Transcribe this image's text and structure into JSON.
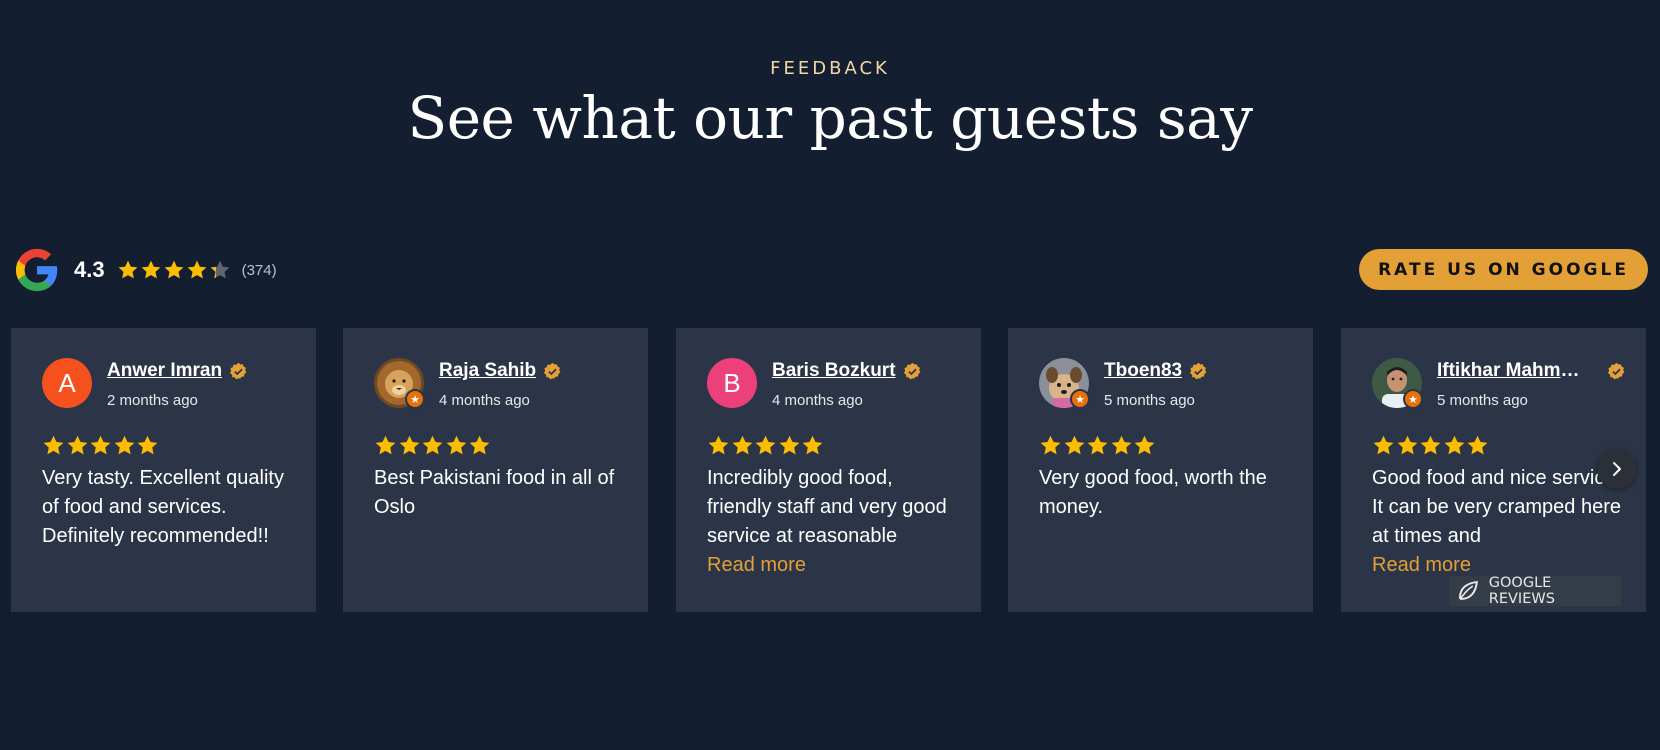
{
  "header": {
    "eyebrow": "FEEDBACK",
    "title": "See what our past guests say"
  },
  "summary": {
    "logo_icon": "google-g-logo-icon",
    "rating": "4.3",
    "rating_value": 4.3,
    "max_stars": 5,
    "count": "(374)",
    "rate_button": "RATE US ON GOOGLE"
  },
  "colors": {
    "background": "#131e30",
    "card": "#2b3547",
    "accent": "#e2a036",
    "star": "#fbbc04",
    "eyebrow": "#f2d7a6"
  },
  "reviews": [
    {
      "name": "Anwer Imran",
      "avatar_letter": "A",
      "avatar_color": "#f4511e",
      "avatar_type": "letter",
      "date": "2 months ago",
      "stars": 5,
      "text": "Very tasty. Excellent quality of food and services. Definitely recommended!!",
      "read_more": ""
    },
    {
      "name": "Raja Sahib",
      "avatar_type": "photo",
      "avatar_icon": "lion-photo-avatar",
      "date": "4 months ago",
      "stars": 5,
      "text": "Best Pakistani food in all of Oslo",
      "read_more": ""
    },
    {
      "name": "Baris Bozkurt",
      "avatar_letter": "B",
      "avatar_color": "#ec407a",
      "avatar_type": "letter",
      "date": "4 months ago",
      "stars": 5,
      "text": "Incredibly good food, friendly staff and very good service at reasonable prices.",
      "read_more": "Read more"
    },
    {
      "name": "Tboen83",
      "avatar_type": "photo",
      "avatar_icon": "dog-photo-avatar",
      "date": "5 months ago",
      "stars": 5,
      "text": "Very good food, worth the money.",
      "read_more": ""
    },
    {
      "name": "Iftikhar Mahmood",
      "avatar_type": "photo",
      "avatar_icon": "person-photo-avatar",
      "date": "5 months ago",
      "stars": 5,
      "text": "Good food and nice service. It can be very cramped here at times and",
      "read_more": "Read more"
    }
  ],
  "carousel": {
    "next_icon": "chevron-right-icon"
  },
  "badge": {
    "label": "GOOGLE REVIEWS",
    "icon": "leaf-logo-icon"
  }
}
